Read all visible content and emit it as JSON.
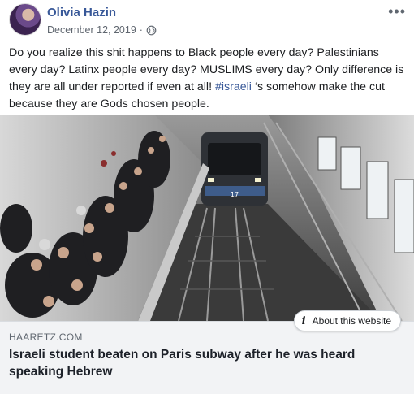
{
  "post": {
    "author": "Olivia Hazin",
    "date": "December 12, 2019",
    "date_separator": "·",
    "privacy_icon": "globe-icon",
    "more_icon": "•••",
    "text_before": "Do you realize this shit happens to Black people every day? Palestinians every day? Latinx people every day? MUSLIMS every day? Only difference is they are all under reported if even at all! ",
    "hashtag": "#israeli",
    "text_after": " ‘s somehow make the cut because they are Gods chosen people."
  },
  "link": {
    "domain": "HAARETZ.COM",
    "title": "Israeli student beaten on Paris subway after he was heard speaking Hebrew",
    "about_label": "About this website",
    "train_number": "17"
  },
  "colors": {
    "link_blue": "#385898",
    "caption_bg": "#f2f3f5",
    "meta_gray": "#606770"
  }
}
